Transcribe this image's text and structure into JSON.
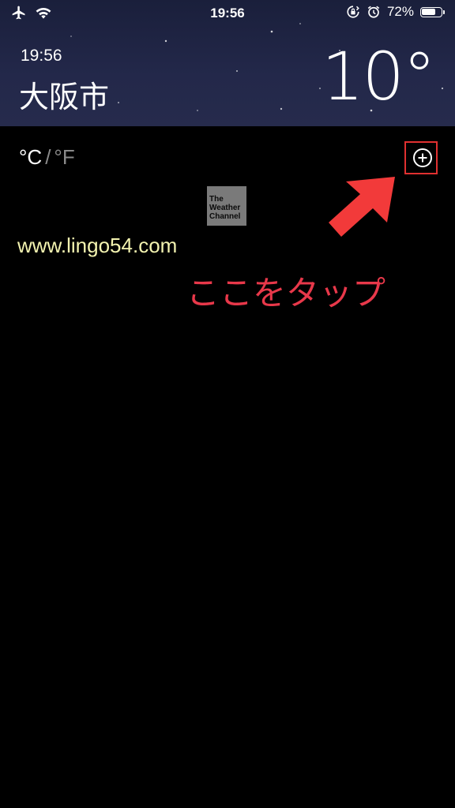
{
  "status_bar": {
    "time": "19:56",
    "battery_percent": "72%",
    "battery_level": 0.72,
    "icons": [
      "airplane-icon",
      "wifi-icon",
      "orientation-lock-icon",
      "alarm-icon",
      "battery-icon"
    ]
  },
  "header": {
    "local_time": "19:56",
    "city": "大阪市",
    "temperature": "10°"
  },
  "units": {
    "celsius": "°C",
    "separator": "/",
    "fahrenheit": "°F"
  },
  "add_button": {
    "icon": "plus-circle-icon"
  },
  "logo": {
    "line1": "The",
    "line2": "Weather",
    "line3": "Channel"
  },
  "annotations": {
    "watermark": "www.lingo54.com",
    "tap_label": "ここをタップ",
    "highlight_color": "#e03030",
    "arrow_color": "#f23a3a"
  }
}
